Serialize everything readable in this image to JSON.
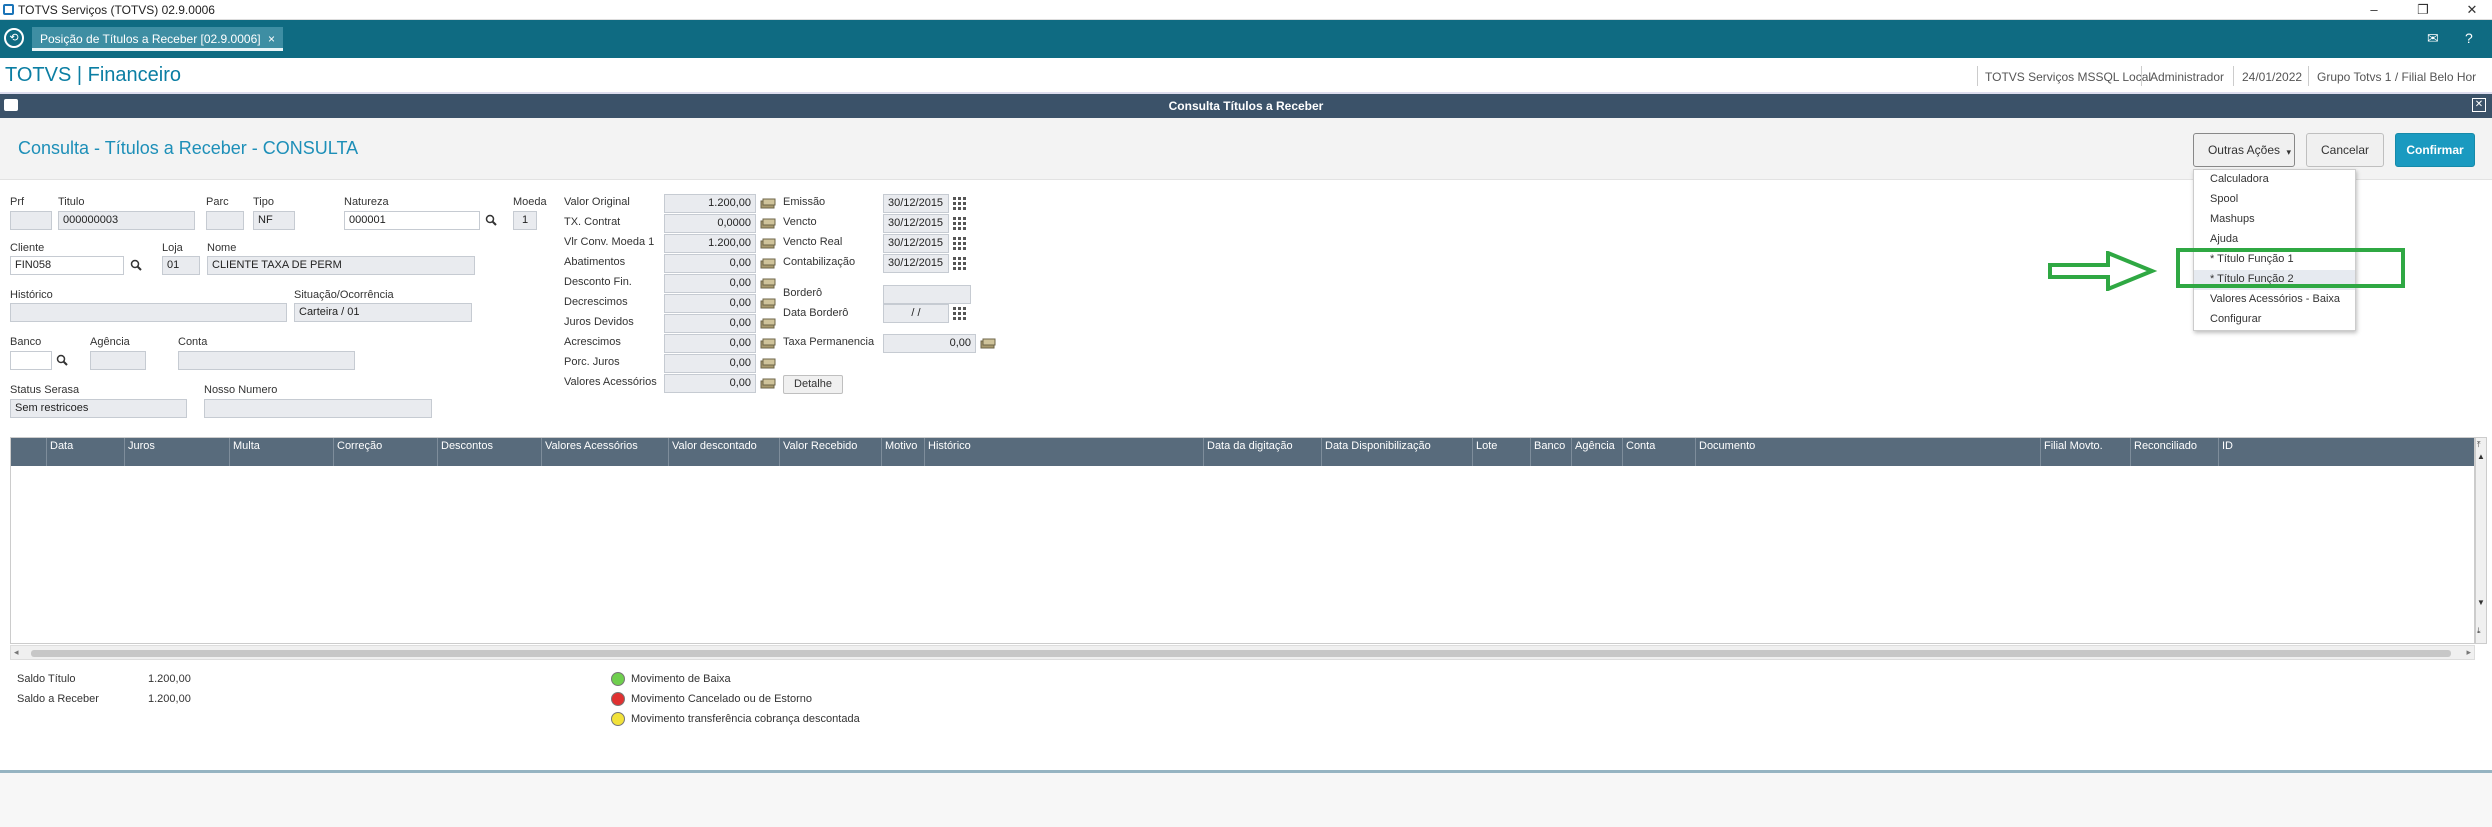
{
  "window": {
    "title": "TOTVS Serviços (TOTVS) 02.9.0006"
  },
  "tab": {
    "label": "Posição de Títulos a Receber [02.9.0006]",
    "close": "×"
  },
  "app": {
    "brand": "TOTVS | Financeiro",
    "environment": "TOTVS Serviços MSSQL Local",
    "user": "Administrador",
    "date": "24/01/2022",
    "branch": "Grupo Totvs 1 / Filial Belo Hor"
  },
  "dialog": {
    "title": "Consulta Títulos a Receber"
  },
  "page": {
    "heading": "Consulta - Títulos a Receber - CONSULTA"
  },
  "buttons": {
    "outras": "Outras Ações",
    "cancelar": "Cancelar",
    "confirmar": "Confirmar",
    "detalhe": "Detalhe"
  },
  "menu": {
    "items": [
      "Calculadora",
      "Spool",
      "Mashups",
      "Ajuda",
      "* Título Função 1",
      "* Título Função 2",
      "Valores Acessórios - Baixa",
      "Configurar"
    ]
  },
  "form": {
    "labels": {
      "prf": "Prf",
      "titulo": "Titulo",
      "parc": "Parc",
      "tipo": "Tipo",
      "natureza": "Natureza",
      "moeda": "Moeda",
      "cliente": "Cliente",
      "loja": "Loja",
      "nome": "Nome",
      "historico": "Histórico",
      "situacao": "Situação/Ocorrência",
      "banco": "Banco",
      "agencia": "Agência",
      "conta": "Conta",
      "status": "Status Serasa",
      "nosso": "Nosso Numero"
    },
    "values": {
      "prf": "",
      "titulo": "000000003",
      "parc": "",
      "tipo": "NF",
      "natureza": "000001",
      "moeda": "1",
      "cliente": "FIN058",
      "loja": "01",
      "nome": "CLIENTE TAXA DE PERM",
      "historico": "",
      "situacao": "Carteira / 01",
      "banco": "",
      "agencia": "",
      "conta": "",
      "status": "Sem restricoes",
      "nosso": ""
    },
    "amounts": [
      {
        "label": "Valor Original",
        "value": "1.200,00"
      },
      {
        "label": "TX. Contrat",
        "value": "0,0000"
      },
      {
        "label": "Vlr Conv. Moeda 1",
        "value": "1.200,00"
      },
      {
        "label": "Abatimentos",
        "value": "0,00"
      },
      {
        "label": "Desconto Fin.",
        "value": "0,00"
      },
      {
        "label": "Decrescimos",
        "value": "0,00"
      },
      {
        "label": "Juros Devidos",
        "value": "0,00"
      },
      {
        "label": "Acrescimos",
        "value": "0,00"
      },
      {
        "label": "Porc. Juros",
        "value": "0,00"
      },
      {
        "label": "Valores Acessórios",
        "value": "0,00"
      }
    ],
    "dates": [
      {
        "label": "Emissão",
        "value": "30/12/2015"
      },
      {
        "label": "Vencto",
        "value": "30/12/2015"
      },
      {
        "label": "Vencto Real",
        "value": "30/12/2015"
      },
      {
        "label": "Contabilização",
        "value": "30/12/2015"
      }
    ],
    "bordero": {
      "label": "Borderô",
      "value": ""
    },
    "data_bordero": {
      "label": "Data Borderô",
      "value": "/ /"
    },
    "taxa": {
      "label": "Taxa Permanencia",
      "value": "0,00"
    }
  },
  "grid": {
    "columns": [
      "",
      "Data",
      "Juros",
      "Multa",
      "Correção",
      "Descontos",
      "Valores Acessórios",
      "Valor descontado",
      "Valor Recebido",
      "Motivo",
      "Histórico",
      "Data da digitação",
      "Data Disponibilização",
      "Lote",
      "Banco",
      "Agência",
      "Conta",
      "Documento",
      "Filial Movto.",
      "Reconciliado",
      "ID"
    ]
  },
  "summary": {
    "saldo_titulo_label": "Saldo Título",
    "saldo_titulo": "1.200,00",
    "saldo_receber_label": "Saldo a Receber",
    "saldo_receber": "1.200,00"
  },
  "legend": [
    {
      "label": "Movimento de Baixa",
      "color": "#6fcf4e"
    },
    {
      "label": "Movimento Cancelado ou de Estorno",
      "color": "#e03131"
    },
    {
      "label": "Movimento transferência cobrança descontada",
      "color": "#f2e23a"
    }
  ],
  "colors": {
    "brand": "#0b7ea3",
    "tabbar": "#0f6b82",
    "dialog": "#3b5269",
    "grid_header": "#586b7c",
    "primary": "#1a9ac0",
    "highlight": "#2fa843"
  }
}
